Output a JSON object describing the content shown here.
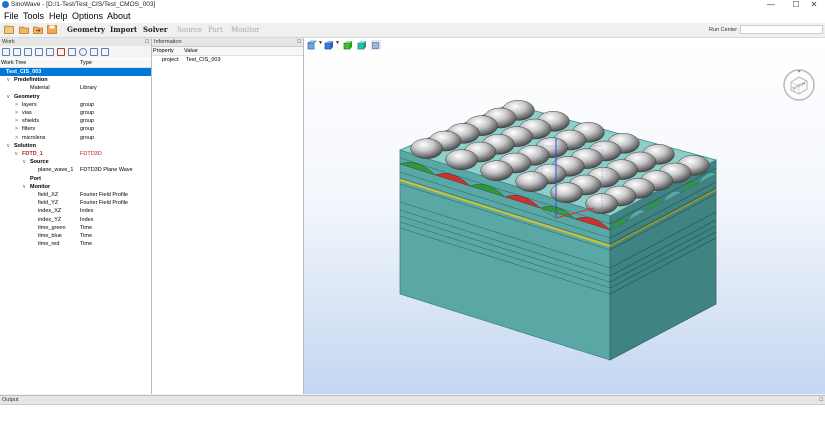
{
  "window": {
    "title": "SinoWave - [D:/1-Test/Test_CIS/Test_CMOS_003]",
    "controls": [
      "—",
      "☐",
      "✕"
    ]
  },
  "menu": [
    "File",
    "Tools",
    "Help",
    "Options",
    "About"
  ],
  "toolbar": {
    "tabs": [
      {
        "label": "Geometry",
        "enabled": true
      },
      {
        "label": "Import",
        "enabled": true
      },
      {
        "label": "Solver",
        "enabled": true
      },
      {
        "label": "Source",
        "enabled": false
      },
      {
        "label": "Port",
        "enabled": false
      },
      {
        "label": "Monitor",
        "enabled": false
      }
    ],
    "run_label": "Run Center",
    "run_value": ""
  },
  "work_panel": {
    "title": "Work",
    "columns": [
      "Work Tree",
      "Type"
    ],
    "rows": [
      {
        "label": "Test_CIS_003",
        "type": "",
        "indent": 0,
        "bold": true,
        "selected": true,
        "arrow": ""
      },
      {
        "label": "Predefinition",
        "type": "",
        "indent": 1,
        "bold": true,
        "arrow": "v"
      },
      {
        "label": "Material",
        "type": "Library",
        "indent": 3
      },
      {
        "label": "Geometry",
        "type": "",
        "indent": 1,
        "bold": true,
        "arrow": "v"
      },
      {
        "label": "layers",
        "type": "group",
        "indent": 2,
        "arrow": ">"
      },
      {
        "label": "vias",
        "type": "group",
        "indent": 2,
        "arrow": ">"
      },
      {
        "label": "shields",
        "type": "group",
        "indent": 2,
        "arrow": ">"
      },
      {
        "label": "filters",
        "type": "group",
        "indent": 2,
        "arrow": ">"
      },
      {
        "label": "microlens",
        "type": "group",
        "indent": 2,
        "arrow": ">"
      },
      {
        "label": "Solution",
        "type": "",
        "indent": 1,
        "bold": true,
        "arrow": "v"
      },
      {
        "label": "FDTD_1",
        "type": "FDTD3D",
        "indent": 2,
        "bold": true,
        "red": true,
        "arrow": "v"
      },
      {
        "label": "Source",
        "type": "",
        "indent": 3,
        "bold": true,
        "arrow": "v"
      },
      {
        "label": "plane_wave_1",
        "type": "FDTD3D Plane Wave",
        "indent": 4
      },
      {
        "label": "Port",
        "type": "",
        "indent": 3,
        "bold": true
      },
      {
        "label": "Monitor",
        "type": "",
        "indent": 3,
        "bold": true,
        "arrow": "v"
      },
      {
        "label": "field_XZ",
        "type": "Fourier Field Profile",
        "indent": 4
      },
      {
        "label": "field_YZ",
        "type": "Fourier Field Profile",
        "indent": 4
      },
      {
        "label": "index_XZ",
        "type": "Index",
        "indent": 4
      },
      {
        "label": "index_YZ",
        "type": "Index",
        "indent": 4
      },
      {
        "label": "time_green",
        "type": "Time",
        "indent": 4
      },
      {
        "label": "time_blue",
        "type": "Time",
        "indent": 4
      },
      {
        "label": "time_red",
        "type": "Time",
        "indent": 4
      }
    ]
  },
  "info_panel": {
    "title": "Information",
    "columns": [
      "Property",
      "Value"
    ],
    "rows": [
      {
        "property": "project",
        "value": "Test_CIS_003"
      }
    ]
  },
  "viewport": {
    "view_cube_label": "BOTTOM",
    "model": {
      "grid_cols": 6,
      "grid_rows": 6
    },
    "colors": {
      "body": "#5aa8a6",
      "body_dark": "#3f8482",
      "body_light": "#8ccfcb",
      "lens": "#9a9a9a",
      "filter_red": "#cc3030",
      "filter_green": "#2f9a3a",
      "filter_yellow": "#d4c02a",
      "axis_blue": "#2a4fd8",
      "axis_red": "#d83030"
    }
  },
  "output_panel": {
    "title": "Output",
    "content": ""
  }
}
